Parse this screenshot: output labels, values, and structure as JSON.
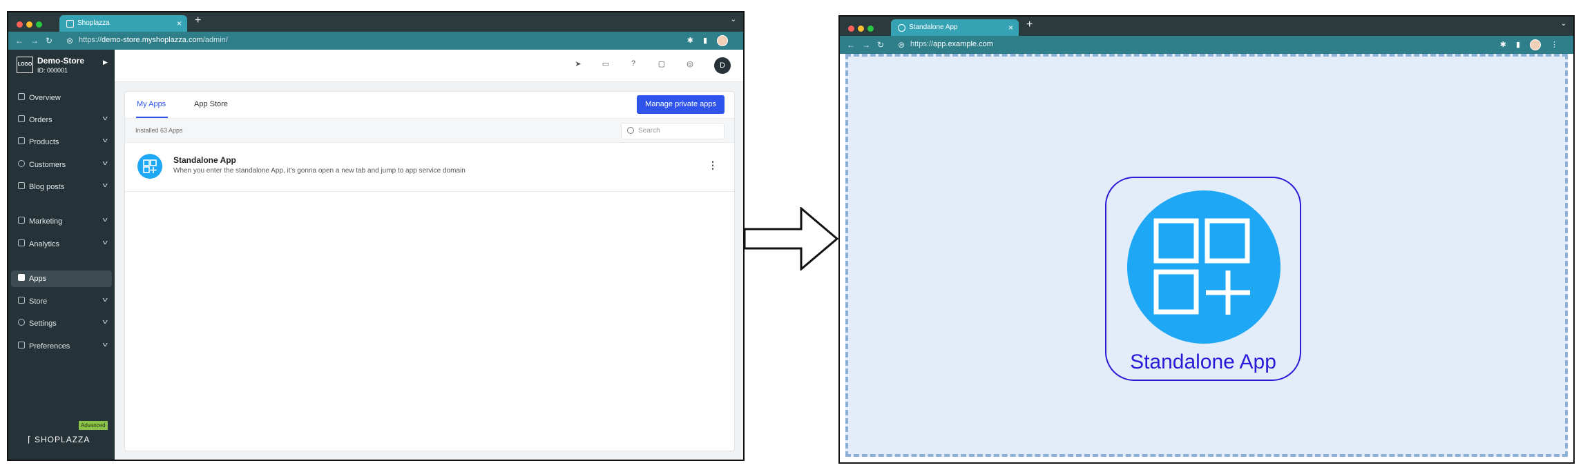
{
  "left_window": {
    "tab_title": "Shoplazza",
    "url_prefix": "https://",
    "url_host": "demo-store.myshoplazza.com",
    "url_path": "/admin/",
    "store_name": "Demo-Store",
    "store_id": "ID: 000001",
    "logo_text": "LOGO",
    "nav": [
      {
        "label": "Overview",
        "icon": "overview-icon"
      },
      {
        "label": "Orders",
        "icon": "orders-icon"
      },
      {
        "label": "Products",
        "icon": "products-icon"
      },
      {
        "label": "Customers",
        "icon": "customers-icon"
      },
      {
        "label": "Blog posts",
        "icon": "blog-icon"
      },
      {
        "label": "Marketing",
        "icon": "marketing-icon"
      },
      {
        "label": "Analytics",
        "icon": "analytics-icon"
      },
      {
        "label": "Apps",
        "icon": "apps-icon"
      },
      {
        "label": "Store",
        "icon": "store-icon"
      },
      {
        "label": "Settings",
        "icon": "settings-icon"
      },
      {
        "label": "Preferences",
        "icon": "preferences-icon"
      }
    ],
    "plan_badge": "Advanced",
    "brand": "SHOPLAZZA",
    "user_initial": "D",
    "tabs": {
      "my_apps": "My Apps",
      "app_store": "App Store"
    },
    "manage_button": "Manage private apps",
    "installed": "Installed 63 Apps",
    "search_placeholder": "Search",
    "app": {
      "name": "Standalone App",
      "description": "When you enter the standalone App, it's gonna open a new tab and jump to app service domain"
    }
  },
  "right_window": {
    "tab_title": "Standalone App",
    "url_prefix": "https://",
    "url_host": "app.example.com",
    "app_title": "Standalone App"
  },
  "colors": {
    "accent": "#2f54eb",
    "app_icon": "#1ea7f5",
    "sidebar": "#253238",
    "titlebar": "#2b3a3d",
    "addressbar": "#2f7f8a"
  }
}
